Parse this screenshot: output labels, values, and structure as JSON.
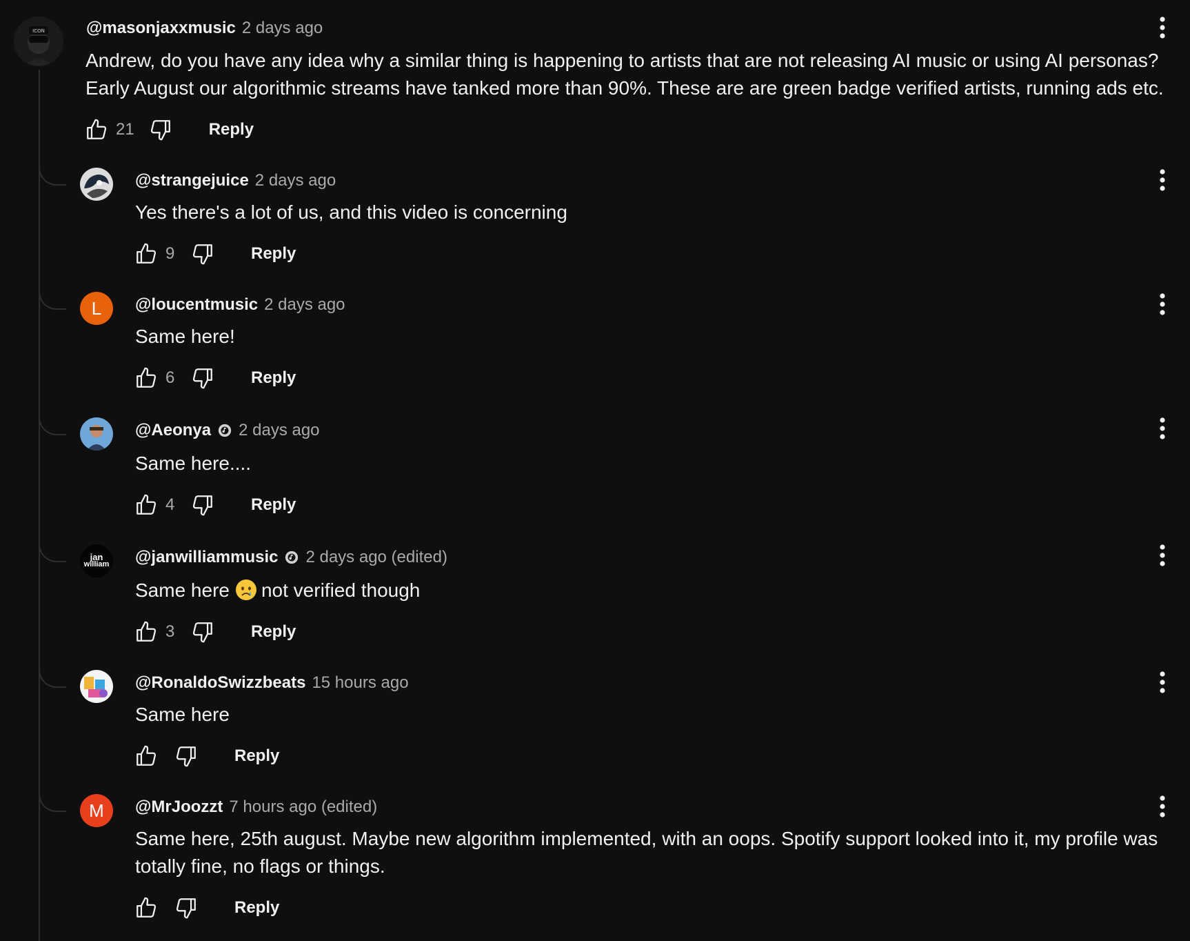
{
  "comment": {
    "author": "@masonjaxxmusic",
    "time": "2 days ago",
    "text_line1": "Andrew, do you have any idea why a similar thing is happening to artists that are not releasing AI music or using AI personas?",
    "text_line2": "Early August our algorithmic streams have tanked more than 90%. These are are green badge verified artists, running ads etc.",
    "likes": "21",
    "reply_label": "Reply"
  },
  "replies": [
    {
      "author": "@strangejuice",
      "time": "2 days ago",
      "text": "Yes there's a lot of us, and this video is concerning",
      "likes": "9",
      "reply_label": "Reply"
    },
    {
      "author": "@loucentmusic",
      "time": "2 days ago",
      "text": "Same here!",
      "likes": "6",
      "reply_label": "Reply",
      "avatar_letter": "L",
      "avatar_color": "#e8620c"
    },
    {
      "author": "@Aeonya",
      "time": "2 days ago",
      "verified": true,
      "text": "Same here....",
      "likes": "4",
      "reply_label": "Reply"
    },
    {
      "author": "@janwilliammusic",
      "time": "2 days ago (edited)",
      "verified": true,
      "text_before_emoji": "Same here",
      "emoji": "crying-face",
      "text_after_emoji": "not verified though",
      "likes": "3",
      "reply_label": "Reply",
      "avatar_text_1": "jan",
      "avatar_text_2": "william"
    },
    {
      "author": "@RonaldoSwizzbeats",
      "time": "15 hours ago",
      "text": "Same here",
      "likes": "",
      "reply_label": "Reply"
    },
    {
      "author": "@MrJoozzt",
      "time": "7 hours ago (edited)",
      "text_line1": "Same here, 25th august. Maybe new algorithm implemented, with an oops. Spotify support looked into it, my profile was",
      "text_line2": "totally fine, no flags or things.",
      "likes": "",
      "reply_label": "Reply",
      "avatar_letter": "M",
      "avatar_color": "#e8401c"
    }
  ],
  "colors": {
    "background": "#0f0f0f",
    "text_primary": "#f1f1f1",
    "text_secondary": "#aaaaaa",
    "thread_line": "#2e2e2e"
  },
  "icons": {
    "like": "thumbs-up-icon",
    "dislike": "thumbs-down-icon",
    "more": "more-vert-icon",
    "verified": "verified-badge-icon"
  }
}
